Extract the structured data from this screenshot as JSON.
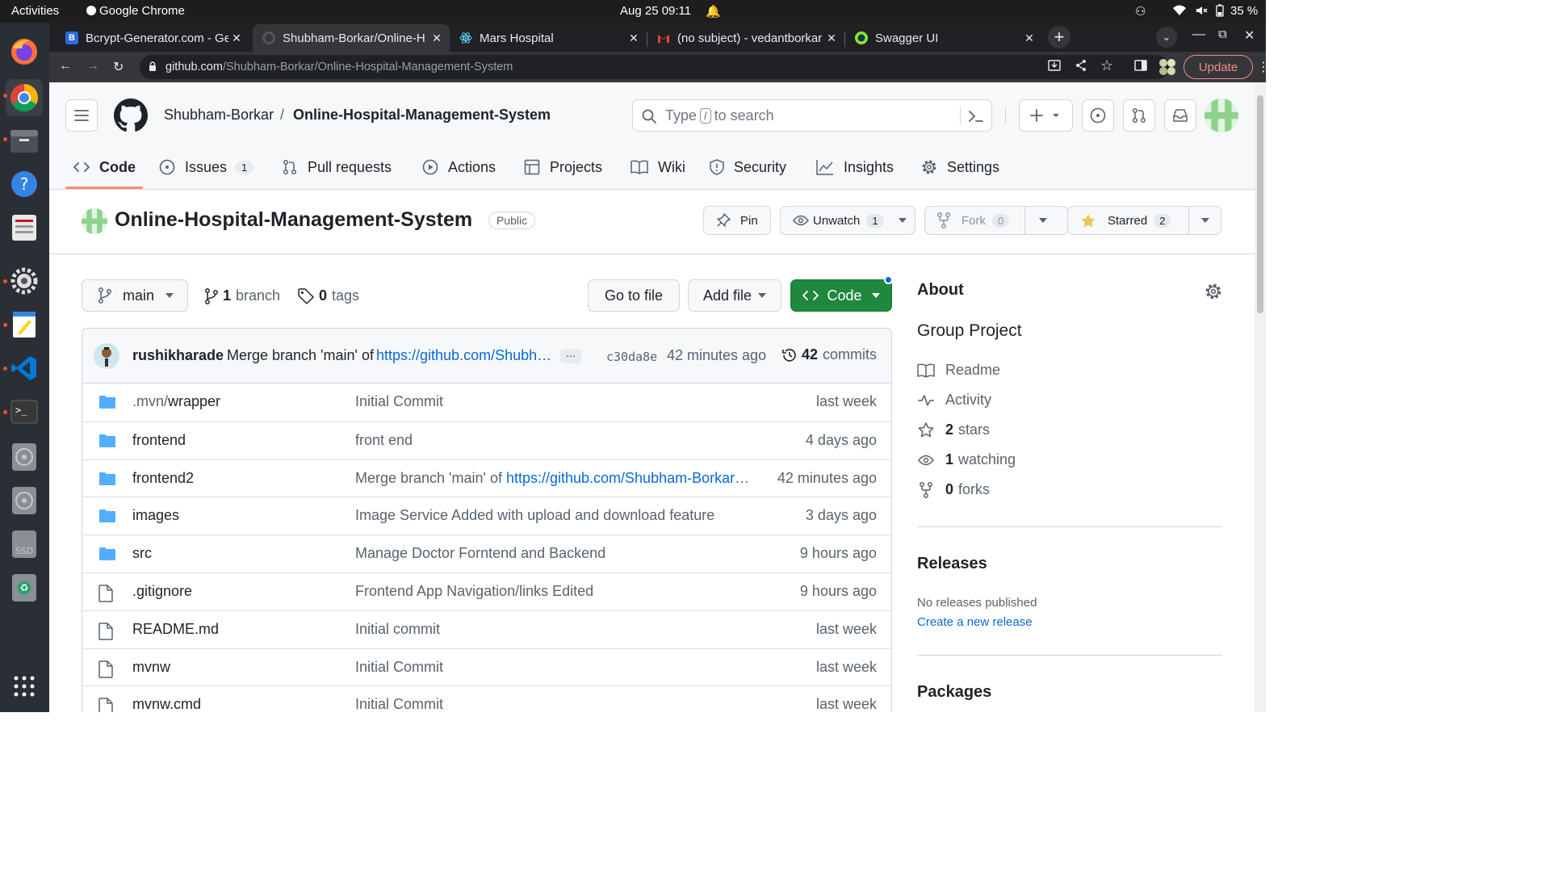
{
  "system": {
    "activities": "Activities",
    "app_name": "Google Chrome",
    "datetime": "Aug 25  09:11",
    "battery": "35 %"
  },
  "browser": {
    "tabs": [
      {
        "title": "Bcrypt-Generator.com - Ge",
        "favicon": "B",
        "color": "#2d6cdf"
      },
      {
        "title": "Shubham-Borkar/Online-H",
        "favicon": "github-icon",
        "color": "#24292f"
      },
      {
        "title": "Mars Hospital",
        "favicon": "react-icon",
        "color": "#61dafb"
      },
      {
        "title": "(no subject) - vedantborkar",
        "favicon": "gmail-icon",
        "color": "#ea4335"
      },
      {
        "title": "Swagger UI",
        "favicon": "swagger-icon",
        "color": "#85ea2d"
      }
    ],
    "url_host": "github.com",
    "url_path": "/Shubham-Borkar/Online-Hospital-Management-System",
    "update_label": "Update"
  },
  "github": {
    "owner": "Shubham-Borkar",
    "separator": "/",
    "repo": "Online-Hospital-Management-System",
    "search_pre": "Type",
    "search_key": "/",
    "search_post": "to search",
    "nav": {
      "code": "Code",
      "issues": "Issues",
      "issues_count": "1",
      "pulls": "Pull requests",
      "actions": "Actions",
      "projects": "Projects",
      "wiki": "Wiki",
      "security": "Security",
      "insights": "Insights",
      "settings": "Settings"
    },
    "visibility": "Public",
    "pin_label": "Pin",
    "unwatch_label": "Unwatch",
    "watch_count": "1",
    "fork_label": "Fork",
    "fork_count": "0",
    "starred_label": "Starred",
    "star_count": "2",
    "branch_name": "main",
    "branch_count": "1",
    "branch_word": "branch",
    "tag_count": "0",
    "tag_word": "tags",
    "go_to_file": "Go to file",
    "add_file": "Add file",
    "code_btn": "Code",
    "commit": {
      "author": "rushikharade",
      "message": "Merge branch 'main' of",
      "link": "https://github.com/Shubh…",
      "sha": "c30da8e",
      "time": "42 minutes ago",
      "count": "42",
      "count_word": "commits"
    },
    "files": [
      {
        "type": "dir",
        "name_dim": ".mvn/",
        "name": "wrapper",
        "msg": "Initial Commit",
        "link": "",
        "time": "last week"
      },
      {
        "type": "dir",
        "name_dim": "",
        "name": "frontend",
        "msg": "front end",
        "link": "",
        "time": "4 days ago"
      },
      {
        "type": "dir",
        "name_dim": "",
        "name": "frontend2",
        "msg": "Merge branch 'main' of ",
        "link": "https://github.com/Shubham-Borkar/…",
        "time": "42 minutes ago"
      },
      {
        "type": "dir",
        "name_dim": "",
        "name": "images",
        "msg": "Image Service Added with upload and download feature",
        "link": "",
        "time": "3 days ago"
      },
      {
        "type": "dir",
        "name_dim": "",
        "name": "src",
        "msg": "Manage Doctor Forntend and Backend",
        "link": "",
        "time": "9 hours ago"
      },
      {
        "type": "file",
        "name_dim": "",
        "name": ".gitignore",
        "msg": "Frontend App Navigation/links Edited",
        "link": "",
        "time": "9 hours ago"
      },
      {
        "type": "file",
        "name_dim": "",
        "name": "README.md",
        "msg": "Initial commit",
        "link": "",
        "time": "last week"
      },
      {
        "type": "file",
        "name_dim": "",
        "name": "mvnw",
        "msg": "Initial Commit",
        "link": "",
        "time": "last week"
      },
      {
        "type": "file",
        "name_dim": "",
        "name": "mvnw.cmd",
        "msg": "Initial Commit",
        "link": "",
        "time": "last week"
      }
    ],
    "about": {
      "heading": "About",
      "description": "Group Project",
      "readme": "Readme",
      "activity": "Activity",
      "stars_count": "2",
      "stars_word": "stars",
      "watching_count": "1",
      "watching_word": "watching",
      "forks_count": "0",
      "forks_word": "forks"
    },
    "releases": {
      "heading": "Releases",
      "none": "No releases published",
      "create": "Create a new release"
    },
    "packages_heading": "Packages"
  }
}
